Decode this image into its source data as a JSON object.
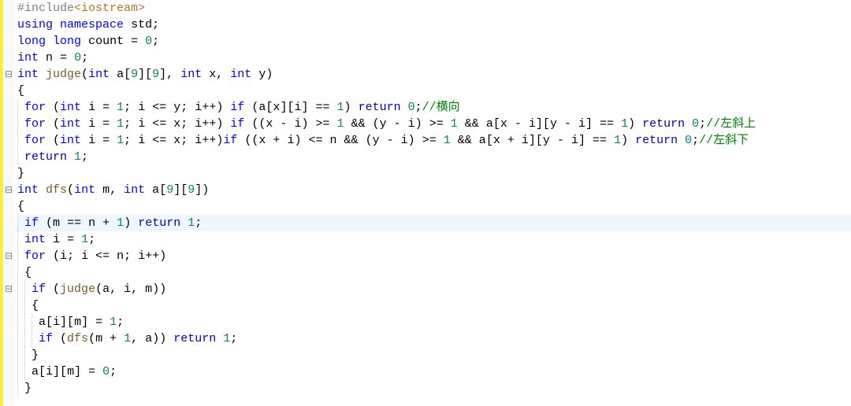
{
  "gutter": [
    "",
    "",
    "",
    "",
    "-",
    "",
    "",
    "",
    "",
    "",
    "",
    "-",
    "",
    "",
    "",
    "-",
    "",
    "-",
    "",
    "",
    "",
    "",
    "",
    ""
  ],
  "lines": [
    [
      [
        "tok-pre",
        "#include"
      ],
      [
        "tok-inc",
        "<iostream>"
      ]
    ],
    [
      [
        "tok-kw",
        "using"
      ],
      [
        "",
        ""
      ],
      [
        "tok-kw",
        "namespace"
      ],
      [
        "",
        ""
      ],
      [
        "tok-id",
        "std"
      ],
      [
        "tok-op",
        ";"
      ]
    ],
    [
      [
        "tok-kw",
        "long"
      ],
      [
        "",
        ""
      ],
      [
        "tok-kw",
        "long"
      ],
      [
        "",
        ""
      ],
      [
        "tok-id",
        "count"
      ],
      [
        "",
        ""
      ],
      [
        "tok-op",
        "="
      ],
      [
        "",
        ""
      ],
      [
        "tok-num",
        "0"
      ],
      [
        "tok-op",
        ";"
      ]
    ],
    [
      [
        "tok-kw",
        "int"
      ],
      [
        "",
        ""
      ],
      [
        "tok-id",
        "n"
      ],
      [
        "",
        ""
      ],
      [
        "tok-op",
        "="
      ],
      [
        "",
        ""
      ],
      [
        "tok-num",
        "0"
      ],
      [
        "tok-op",
        ";"
      ]
    ],
    [
      [
        "tok-kw",
        "int"
      ],
      [
        "",
        ""
      ],
      [
        "tok-fn",
        "judge"
      ],
      [
        "tok-op",
        "("
      ],
      [
        "tok-kw",
        "int"
      ],
      [
        "",
        ""
      ],
      [
        "tok-id",
        "a"
      ],
      [
        "tok-op",
        "["
      ],
      [
        "tok-num",
        "9"
      ],
      [
        "tok-op",
        "]["
      ],
      [
        "tok-num",
        "9"
      ],
      [
        "tok-op",
        "],"
      ],
      [
        "",
        ""
      ],
      [
        "tok-kw",
        "int"
      ],
      [
        "",
        ""
      ],
      [
        "tok-id",
        "x"
      ],
      [
        "tok-op",
        ","
      ],
      [
        "",
        ""
      ],
      [
        "tok-kw",
        "int"
      ],
      [
        "",
        ""
      ],
      [
        "tok-id",
        "y"
      ],
      [
        "tok-op",
        ")"
      ]
    ],
    [
      [
        "tok-op",
        "{"
      ]
    ],
    [
      [
        "",
        "    "
      ],
      [
        "tok-kw",
        "for"
      ],
      [
        "",
        ""
      ],
      [
        "tok-op",
        "("
      ],
      [
        "tok-kw",
        "int"
      ],
      [
        "",
        ""
      ],
      [
        "tok-id",
        "i"
      ],
      [
        "",
        ""
      ],
      [
        "tok-op",
        "="
      ],
      [
        "",
        ""
      ],
      [
        "tok-num",
        "1"
      ],
      [
        "tok-op",
        ";"
      ],
      [
        "",
        ""
      ],
      [
        "tok-id",
        "i"
      ],
      [
        "",
        ""
      ],
      [
        "tok-op",
        "<="
      ],
      [
        "",
        ""
      ],
      [
        "tok-id",
        "y"
      ],
      [
        "tok-op",
        ";"
      ],
      [
        "",
        ""
      ],
      [
        "tok-id",
        "i"
      ],
      [
        "tok-op",
        "++)"
      ],
      [
        "",
        ""
      ],
      [
        "tok-kw",
        "if"
      ],
      [
        "",
        ""
      ],
      [
        "tok-op",
        "("
      ],
      [
        "tok-id",
        "a"
      ],
      [
        "tok-op",
        "["
      ],
      [
        "tok-id",
        "x"
      ],
      [
        "tok-op",
        "]["
      ],
      [
        "tok-id",
        "i"
      ],
      [
        "tok-op",
        "]"
      ],
      [
        "",
        ""
      ],
      [
        "tok-op",
        "=="
      ],
      [
        "",
        ""
      ],
      [
        "tok-num",
        "1"
      ],
      [
        "tok-op",
        ")"
      ],
      [
        "",
        ""
      ],
      [
        "tok-ret",
        "return"
      ],
      [
        "",
        ""
      ],
      [
        "tok-num",
        "0"
      ],
      [
        "tok-op",
        ";"
      ],
      [
        "tok-cmt",
        "//横向"
      ]
    ],
    [
      [
        "",
        "    "
      ],
      [
        "tok-kw",
        "for"
      ],
      [
        "",
        ""
      ],
      [
        "tok-op",
        "("
      ],
      [
        "tok-kw",
        "int"
      ],
      [
        "",
        ""
      ],
      [
        "tok-id",
        "i"
      ],
      [
        "",
        ""
      ],
      [
        "tok-op",
        "="
      ],
      [
        "",
        ""
      ],
      [
        "tok-num",
        "1"
      ],
      [
        "tok-op",
        ";"
      ],
      [
        "",
        ""
      ],
      [
        "tok-id",
        "i"
      ],
      [
        "",
        ""
      ],
      [
        "tok-op",
        "<="
      ],
      [
        "",
        ""
      ],
      [
        "tok-id",
        "x"
      ],
      [
        "tok-op",
        ";"
      ],
      [
        "",
        ""
      ],
      [
        "tok-id",
        "i"
      ],
      [
        "tok-op",
        "++)"
      ],
      [
        "",
        ""
      ],
      [
        "tok-kw",
        "if"
      ],
      [
        "",
        ""
      ],
      [
        "tok-op",
        "(("
      ],
      [
        "tok-id",
        "x"
      ],
      [
        "",
        ""
      ],
      [
        "tok-op",
        "-"
      ],
      [
        "",
        ""
      ],
      [
        "tok-id",
        "i"
      ],
      [
        "tok-op",
        ")"
      ],
      [
        "",
        ""
      ],
      [
        "tok-op",
        ">="
      ],
      [
        "",
        ""
      ],
      [
        "tok-num",
        "1"
      ],
      [
        "",
        ""
      ],
      [
        "tok-op",
        "&&"
      ],
      [
        "",
        ""
      ],
      [
        "tok-op",
        "("
      ],
      [
        "tok-id",
        "y"
      ],
      [
        "",
        ""
      ],
      [
        "tok-op",
        "-"
      ],
      [
        "",
        ""
      ],
      [
        "tok-id",
        "i"
      ],
      [
        "tok-op",
        ")"
      ],
      [
        "",
        ""
      ],
      [
        "tok-op",
        ">="
      ],
      [
        "",
        ""
      ],
      [
        "tok-num",
        "1"
      ],
      [
        "",
        ""
      ],
      [
        "tok-op",
        "&&"
      ],
      [
        "",
        ""
      ],
      [
        "tok-id",
        "a"
      ],
      [
        "tok-op",
        "["
      ],
      [
        "tok-id",
        "x"
      ],
      [
        "",
        ""
      ],
      [
        "tok-op",
        "-"
      ],
      [
        "",
        ""
      ],
      [
        "tok-id",
        "i"
      ],
      [
        "tok-op",
        "]["
      ],
      [
        "tok-id",
        "y"
      ],
      [
        "",
        ""
      ],
      [
        "tok-op",
        "-"
      ],
      [
        "",
        ""
      ],
      [
        "tok-id",
        "i"
      ],
      [
        "tok-op",
        "]"
      ],
      [
        "",
        ""
      ],
      [
        "tok-op",
        "=="
      ],
      [
        "",
        ""
      ],
      [
        "tok-num",
        "1"
      ],
      [
        "tok-op",
        ")"
      ],
      [
        "",
        ""
      ],
      [
        "tok-ret",
        "return"
      ],
      [
        "",
        ""
      ],
      [
        "tok-num",
        "0"
      ],
      [
        "tok-op",
        ";"
      ],
      [
        "tok-cmt",
        "//左斜上"
      ]
    ],
    [
      [
        "",
        "    "
      ],
      [
        "tok-kw",
        "for"
      ],
      [
        "",
        ""
      ],
      [
        "tok-op",
        "("
      ],
      [
        "tok-kw",
        "int"
      ],
      [
        "",
        ""
      ],
      [
        "tok-id",
        "i"
      ],
      [
        "",
        ""
      ],
      [
        "tok-op",
        "="
      ],
      [
        "",
        ""
      ],
      [
        "tok-num",
        "1"
      ],
      [
        "tok-op",
        ";"
      ],
      [
        "",
        ""
      ],
      [
        "tok-id",
        "i"
      ],
      [
        "",
        ""
      ],
      [
        "tok-op",
        "<="
      ],
      [
        "",
        ""
      ],
      [
        "tok-id",
        "x"
      ],
      [
        "tok-op",
        ";"
      ],
      [
        "",
        ""
      ],
      [
        "tok-id",
        "i"
      ],
      [
        "tok-op",
        "++)"
      ],
      [
        "tok-kw",
        "if"
      ],
      [
        "",
        ""
      ],
      [
        "tok-op",
        "(("
      ],
      [
        "tok-id",
        "x"
      ],
      [
        "",
        ""
      ],
      [
        "tok-op",
        "+"
      ],
      [
        "",
        ""
      ],
      [
        "tok-id",
        "i"
      ],
      [
        "tok-op",
        ")"
      ],
      [
        "",
        ""
      ],
      [
        "tok-op",
        "<="
      ],
      [
        "",
        ""
      ],
      [
        "tok-id",
        "n"
      ],
      [
        "",
        ""
      ],
      [
        "tok-op",
        "&&"
      ],
      [
        "",
        ""
      ],
      [
        "tok-op",
        "("
      ],
      [
        "tok-id",
        "y"
      ],
      [
        "",
        ""
      ],
      [
        "tok-op",
        "-"
      ],
      [
        "",
        ""
      ],
      [
        "tok-id",
        "i"
      ],
      [
        "tok-op",
        ")"
      ],
      [
        "",
        ""
      ],
      [
        "tok-op",
        ">="
      ],
      [
        "",
        ""
      ],
      [
        "tok-num",
        "1"
      ],
      [
        "",
        ""
      ],
      [
        "tok-op",
        "&&"
      ],
      [
        "",
        ""
      ],
      [
        "tok-id",
        "a"
      ],
      [
        "tok-op",
        "["
      ],
      [
        "tok-id",
        "x"
      ],
      [
        "",
        ""
      ],
      [
        "tok-op",
        "+"
      ],
      [
        "",
        ""
      ],
      [
        "tok-id",
        "i"
      ],
      [
        "tok-op",
        "]["
      ],
      [
        "tok-id",
        "y"
      ],
      [
        "",
        ""
      ],
      [
        "tok-op",
        "-"
      ],
      [
        "",
        ""
      ],
      [
        "tok-id",
        "i"
      ],
      [
        "tok-op",
        "]"
      ],
      [
        "",
        ""
      ],
      [
        "tok-op",
        "=="
      ],
      [
        "",
        ""
      ],
      [
        "tok-num",
        "1"
      ],
      [
        "tok-op",
        ")"
      ],
      [
        "",
        ""
      ],
      [
        "tok-ret",
        "return"
      ],
      [
        "",
        ""
      ],
      [
        "tok-num",
        "0"
      ],
      [
        "tok-op",
        ";"
      ],
      [
        "tok-cmt",
        "//左斜下"
      ]
    ],
    [
      [
        "",
        "    "
      ],
      [
        "tok-ret",
        "return"
      ],
      [
        "",
        ""
      ],
      [
        "tok-num",
        "1"
      ],
      [
        "tok-op",
        ";"
      ]
    ],
    [
      [
        "tok-op",
        "}"
      ]
    ],
    [
      [
        "tok-kw",
        "int"
      ],
      [
        "",
        ""
      ],
      [
        "tok-fn",
        "dfs"
      ],
      [
        "tok-op",
        "("
      ],
      [
        "tok-kw",
        "int"
      ],
      [
        "",
        ""
      ],
      [
        "tok-id",
        "m"
      ],
      [
        "tok-op",
        ","
      ],
      [
        "",
        ""
      ],
      [
        "tok-kw",
        "int"
      ],
      [
        "",
        ""
      ],
      [
        "tok-id",
        "a"
      ],
      [
        "tok-op",
        "["
      ],
      [
        "tok-num",
        "9"
      ],
      [
        "tok-op",
        "]["
      ],
      [
        "tok-num",
        "9"
      ],
      [
        "tok-op",
        "])"
      ]
    ],
    [
      [
        "tok-op",
        "{"
      ]
    ],
    [
      [
        "",
        "    "
      ],
      [
        "tok-kw",
        "if"
      ],
      [
        "",
        ""
      ],
      [
        "tok-op",
        "("
      ],
      [
        "tok-id",
        "m"
      ],
      [
        "",
        ""
      ],
      [
        "tok-op",
        "=="
      ],
      [
        "",
        ""
      ],
      [
        "tok-id",
        "n"
      ],
      [
        "",
        ""
      ],
      [
        "tok-op",
        "+"
      ],
      [
        "",
        ""
      ],
      [
        "tok-num",
        "1"
      ],
      [
        "tok-op",
        ")"
      ],
      [
        "",
        ""
      ],
      [
        "tok-ret",
        "return"
      ],
      [
        "",
        ""
      ],
      [
        "tok-num",
        "1"
      ],
      [
        "tok-op",
        ";"
      ]
    ],
    [
      [
        "",
        "    "
      ],
      [
        "tok-kw",
        "int"
      ],
      [
        "",
        ""
      ],
      [
        "tok-id",
        "i"
      ],
      [
        "",
        ""
      ],
      [
        "tok-op",
        "="
      ],
      [
        "",
        ""
      ],
      [
        "tok-num",
        "1"
      ],
      [
        "tok-op",
        ";"
      ]
    ],
    [
      [
        "",
        "    "
      ],
      [
        "tok-kw",
        "for"
      ],
      [
        "",
        ""
      ],
      [
        "tok-op",
        "("
      ],
      [
        "tok-id",
        "i"
      ],
      [
        "tok-op",
        ";"
      ],
      [
        "",
        ""
      ],
      [
        "tok-id",
        "i"
      ],
      [
        "",
        ""
      ],
      [
        "tok-op",
        "<="
      ],
      [
        "",
        ""
      ],
      [
        "tok-id",
        "n"
      ],
      [
        "tok-op",
        ";"
      ],
      [
        "",
        ""
      ],
      [
        "tok-id",
        "i"
      ],
      [
        "tok-op",
        "++)"
      ]
    ],
    [
      [
        "",
        "    "
      ],
      [
        "tok-op",
        "{"
      ]
    ],
    [
      [
        "",
        "        "
      ],
      [
        "tok-kw",
        "if"
      ],
      [
        "",
        ""
      ],
      [
        "tok-op",
        "("
      ],
      [
        "tok-fn",
        "judge"
      ],
      [
        "tok-op",
        "("
      ],
      [
        "tok-id",
        "a"
      ],
      [
        "tok-op",
        ","
      ],
      [
        "",
        ""
      ],
      [
        "tok-id",
        "i"
      ],
      [
        "tok-op",
        ","
      ],
      [
        "",
        ""
      ],
      [
        "tok-id",
        "m"
      ],
      [
        "tok-op",
        "))"
      ]
    ],
    [
      [
        "",
        "        "
      ],
      [
        "tok-op",
        "{"
      ]
    ],
    [
      [
        "",
        "            "
      ],
      [
        "tok-id",
        "a"
      ],
      [
        "tok-op",
        "["
      ],
      [
        "tok-id",
        "i"
      ],
      [
        "tok-op",
        "]["
      ],
      [
        "tok-id",
        "m"
      ],
      [
        "tok-op",
        "]"
      ],
      [
        "",
        ""
      ],
      [
        "tok-op",
        "="
      ],
      [
        "",
        ""
      ],
      [
        "tok-num",
        "1"
      ],
      [
        "tok-op",
        ";"
      ]
    ],
    [
      [
        "",
        "            "
      ],
      [
        "tok-kw",
        "if"
      ],
      [
        "",
        ""
      ],
      [
        "tok-op",
        "("
      ],
      [
        "tok-fn",
        "dfs"
      ],
      [
        "tok-op",
        "("
      ],
      [
        "tok-id",
        "m"
      ],
      [
        "",
        ""
      ],
      [
        "tok-op",
        "+"
      ],
      [
        "",
        ""
      ],
      [
        "tok-num",
        "1"
      ],
      [
        "tok-op",
        ","
      ],
      [
        "",
        ""
      ],
      [
        "tok-id",
        "a"
      ],
      [
        "tok-op",
        "))"
      ],
      [
        "",
        ""
      ],
      [
        "tok-ret",
        "return"
      ],
      [
        "",
        ""
      ],
      [
        "tok-num",
        "1"
      ],
      [
        "tok-op",
        ";"
      ]
    ],
    [
      [
        "",
        "        "
      ],
      [
        "tok-op",
        "}"
      ]
    ],
    [
      [
        "",
        "        "
      ],
      [
        "tok-id",
        "a"
      ],
      [
        "tok-op",
        "["
      ],
      [
        "tok-id",
        "i"
      ],
      [
        "tok-op",
        "]["
      ],
      [
        "tok-id",
        "m"
      ],
      [
        "tok-op",
        "]"
      ],
      [
        "",
        ""
      ],
      [
        "tok-op",
        "="
      ],
      [
        "",
        ""
      ],
      [
        "tok-num",
        "0"
      ],
      [
        "tok-op",
        ";"
      ]
    ],
    [
      [
        "",
        "    "
      ],
      [
        "tok-op",
        "}"
      ]
    ]
  ],
  "highlight_index": 13
}
